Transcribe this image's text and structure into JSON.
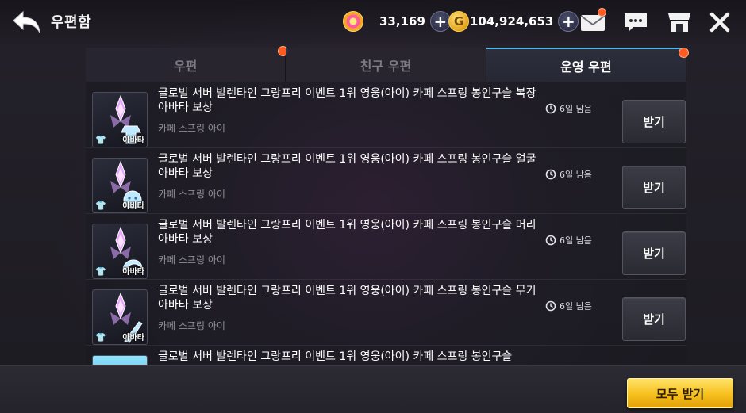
{
  "header": {
    "title": "우편함",
    "gems": "33,169",
    "gold": "104,924,653",
    "gold_symbol": "G"
  },
  "tabs": [
    {
      "label": "우편",
      "active": false,
      "notification": true
    },
    {
      "label": "친구 우편",
      "active": false,
      "notification": false
    },
    {
      "label": "운영 우편",
      "active": true,
      "notification": true
    }
  ],
  "mails": [
    {
      "title": "글로벌 서버 발렌타인 그랑프리 이벤트 1위 영웅(아이) 카페 스프링 봉인구슬 복장 아바타 보상",
      "sender": "카페 스프링 아이",
      "expiry": "6일 남음",
      "button": "받기",
      "thumb_caption": "아바타",
      "icon": "clothing-avatar-icon"
    },
    {
      "title": "글로벌 서버 발렌타인 그랑프리 이벤트 1위 영웅(아이) 카페 스프링 봉인구슬 얼굴 아바타 보상",
      "sender": "카페 스프링 아이",
      "expiry": "6일 남음",
      "button": "받기",
      "thumb_caption": "아바타",
      "icon": "face-avatar-icon"
    },
    {
      "title": "글로벌 서버 발렌타인 그랑프리 이벤트 1위 영웅(아이) 카페 스프링 봉인구슬 머리 아바타 보상",
      "sender": "카페 스프링 아이",
      "expiry": "6일 남음",
      "button": "받기",
      "thumb_caption": "아바타",
      "icon": "hair-avatar-icon"
    },
    {
      "title": "글로벌 서버 발렌타인 그랑프리 이벤트 1위 영웅(아이) 카페 스프링 봉인구슬 무기 아바타 보상",
      "sender": "카페 스프링 아이",
      "expiry": "6일 남음",
      "button": "받기",
      "thumb_caption": "아바타",
      "icon": "weapon-avatar-icon"
    },
    {
      "title": "글로벌 서버 발렌타인 그랑프리 이벤트 1위 영웅(아이) 카페 스프링 봉인구슬"
    }
  ],
  "footer": {
    "claim_all": "모두 받기"
  },
  "colors": {
    "accent_tab": "#4fb5e6",
    "notification": "#ff5a1f",
    "claim_all_bg": "#f6bf1c"
  }
}
